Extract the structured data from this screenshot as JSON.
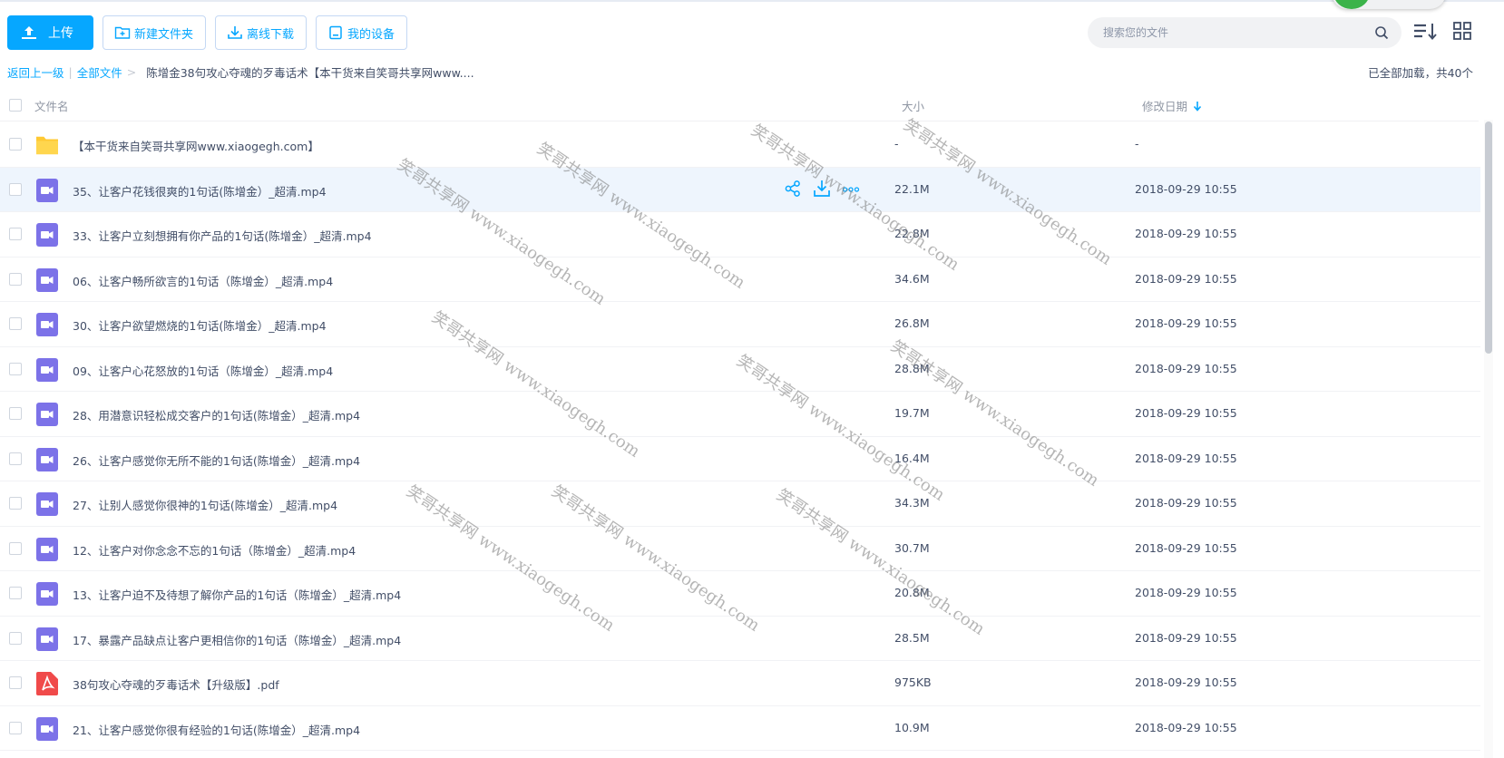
{
  "toolbar": {
    "upload_label": "上传",
    "new_folder_label": "新建文件夹",
    "offline_download_label": "离线下载",
    "my_devices_label": "我的设备"
  },
  "search": {
    "placeholder": "搜索您的文件"
  },
  "breadcrumb": {
    "back_label": "返回上一级",
    "root_label": "全部文件",
    "current_label": "陈增金38句攻心夺魂的歹毒话术【本干货来自笑哥共享网www...."
  },
  "status": {
    "loaded_text": "已全部加载，共40个"
  },
  "table": {
    "col_name": "文件名",
    "col_size": "大小",
    "col_date": "修改日期"
  },
  "files": [
    {
      "type": "folder",
      "name": "【本干货来自笑哥共享网www.xiaogegh.com】",
      "size": "-",
      "date": "-"
    },
    {
      "type": "video",
      "name": "35、让客户花钱很爽的1句话(陈增金）_超清.mp4",
      "size": "22.1M",
      "date": "2018-09-29 10:55"
    },
    {
      "type": "video",
      "name": "33、让客户立刻想拥有你产品的1句话(陈增金）_超清.mp4",
      "size": "22.8M",
      "date": "2018-09-29 10:55"
    },
    {
      "type": "video",
      "name": "06、让客户畅所欲言的1句话（陈增金）_超清.mp4",
      "size": "34.6M",
      "date": "2018-09-29 10:55"
    },
    {
      "type": "video",
      "name": "30、让客户欲望燃烧的1句话(陈增金）_超清.mp4",
      "size": "26.8M",
      "date": "2018-09-29 10:55"
    },
    {
      "type": "video",
      "name": "09、让客户心花怒放的1句话（陈增金）_超清.mp4",
      "size": "28.8M",
      "date": "2018-09-29 10:55"
    },
    {
      "type": "video",
      "name": "28、用潜意识轻松成交客户的1句话(陈增金）_超清.mp4",
      "size": "19.7M",
      "date": "2018-09-29 10:55"
    },
    {
      "type": "video",
      "name": "26、让客户感觉你无所不能的1句话(陈增金）_超清.mp4",
      "size": "16.4M",
      "date": "2018-09-29 10:55"
    },
    {
      "type": "video",
      "name": "27、让别人感觉你很神的1句话(陈增金）_超清.mp4",
      "size": "34.3M",
      "date": "2018-09-29 10:55"
    },
    {
      "type": "video",
      "name": "12、让客户对你念念不忘的1句话（陈增金）_超清.mp4",
      "size": "30.7M",
      "date": "2018-09-29 10:55"
    },
    {
      "type": "video",
      "name": "13、让客户迫不及待想了解你产品的1句话（陈增金）_超清.mp4",
      "size": "20.8M",
      "date": "2018-09-29 10:55"
    },
    {
      "type": "video",
      "name": "17、暴露产品缺点让客户更相信你的1句话（陈增金）_超清.mp4",
      "size": "28.5M",
      "date": "2018-09-29 10:55"
    },
    {
      "type": "pdf",
      "name": "38句攻心夺魂的歹毒话术【升级版】.pdf",
      "size": "975KB",
      "date": "2018-09-29 10:55"
    },
    {
      "type": "video",
      "name": "21、让客户感觉你很有经验的1句话(陈增金）_超清.mp4",
      "size": "10.9M",
      "date": "2018-09-29 10:55"
    }
  ],
  "watermark": {
    "text": "笑哥共享网 www.xiaogegh.com"
  },
  "colors": {
    "accent": "#06a7ff",
    "video_icon": "#7c72e8",
    "folder_icon": "#ffc933",
    "pdf_icon": "#f04a4a",
    "hover_row": "#eef5fd"
  }
}
